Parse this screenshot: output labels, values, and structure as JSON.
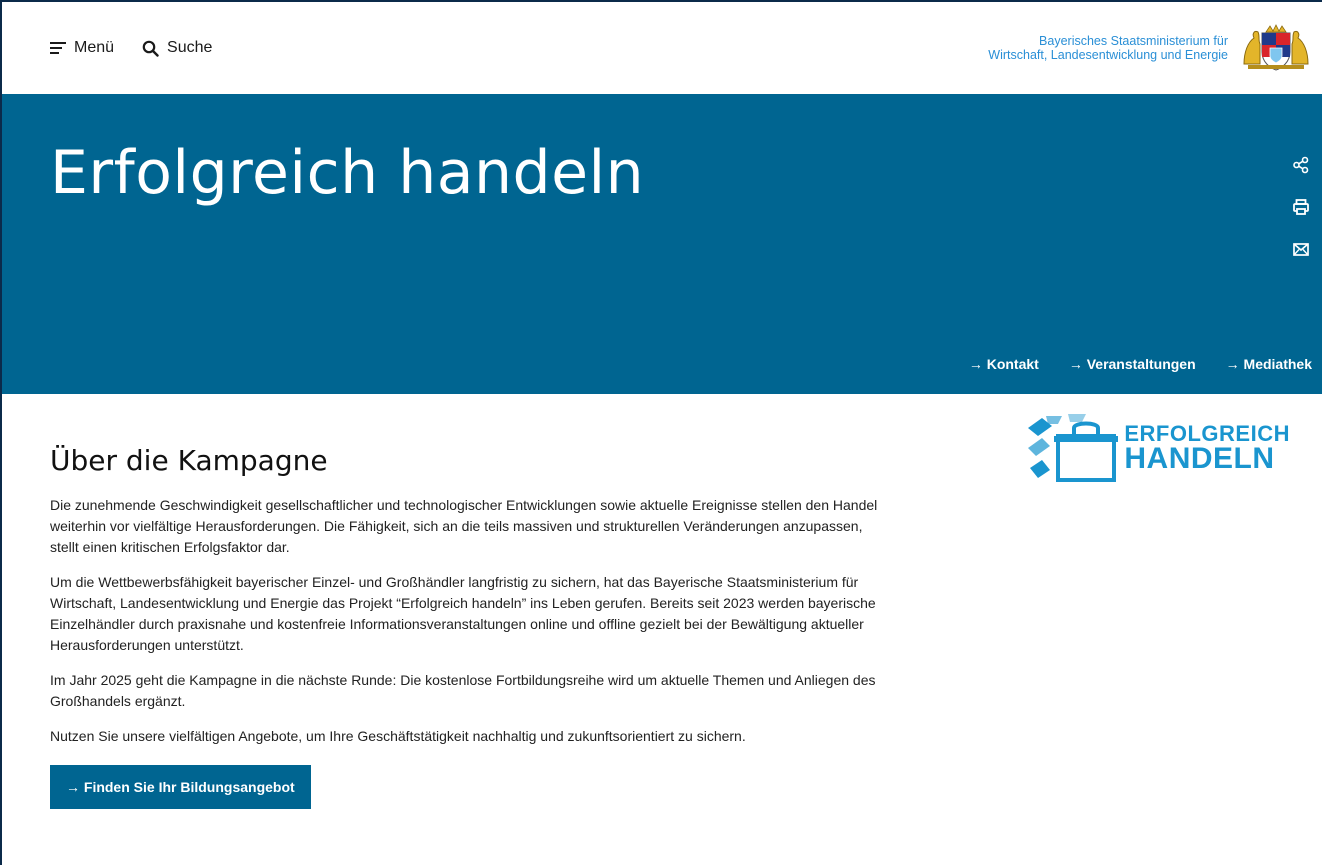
{
  "header": {
    "menu_label": "Menü",
    "search_label": "Suche",
    "ministry_line1": "Bayerisches Staatsministerium für",
    "ministry_line2": "Wirtschaft, Landesentwicklung und Energie"
  },
  "hero": {
    "title": "Erfolgreich handeln",
    "links": [
      {
        "label": "→ Kontakt"
      },
      {
        "label": "→ Veranstaltungen"
      },
      {
        "label": "→ Mediathek"
      }
    ],
    "tools": [
      "share-icon",
      "print-icon",
      "mail-icon"
    ]
  },
  "main": {
    "heading": "Über die Kampagne",
    "paragraphs": [
      "Die zunehmende Geschwindigkeit gesellschaftlicher und technologischer Entwicklungen sowie aktuelle Ereignisse stellen den Handel weiterhin vor vielfältige Herausforderungen. Die Fähigkeit, sich an die teils massiven und strukturellen Veränderungen anzupassen, stellt einen kritischen Erfolgsfaktor dar.",
      "Um die Wettbewerbsfähigkeit bayerischer Einzel- und Großhändler langfristig zu sichern, hat das Bayerische Staatsministerium für Wirtschaft, Landesentwicklung und Energie das Projekt “Erfolgreich handeln” ins Leben gerufen. Bereits seit 2023 werden bayerische Einzelhändler durch praxisnahe und kostenfreie Informationsveranstaltungen online und offline gezielt bei der Bewältigung aktueller Herausforderungen unterstützt.",
      "Im Jahr 2025 geht die Kampagne in die nächste Runde: Die kostenlose Fortbildungsreihe wird um aktuelle Themen und Anliegen des Großhandels ergänzt.",
      "Nutzen Sie unsere vielfältigen Angebote, um Ihre Geschäftstätigkeit nachhaltig und zukunftsorientiert zu sichern."
    ],
    "cta_label": "→ Finden Sie Ihr Bildungsangebot"
  },
  "campaign_logo": {
    "line1": "ERFOLGREICH",
    "line2": "HANDELN"
  },
  "colors": {
    "brand_blue": "#006591",
    "ministry_text": "#2a8fd6",
    "logo_blue": "#1a95cf"
  }
}
